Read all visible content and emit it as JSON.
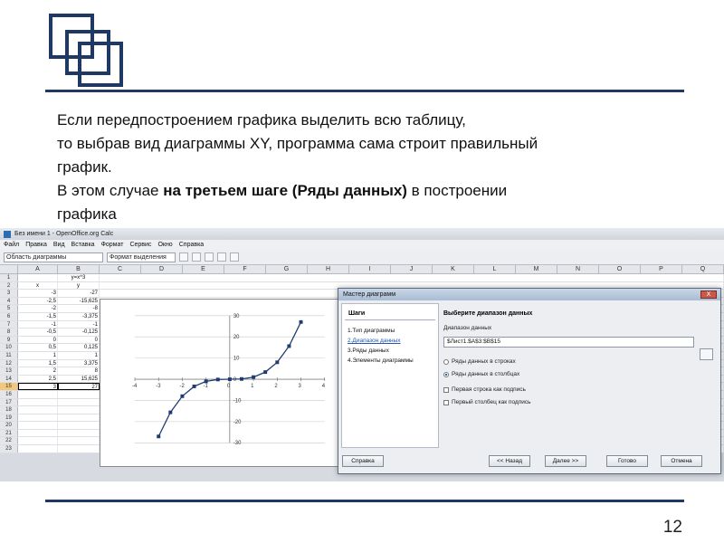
{
  "slide": {
    "paragraph": {
      "line1": "Если передпостроением графика выделить всю таблицу,",
      "line2": "то выбрав вид диаграммы XY, программа сама строит правильный",
      "line3": "график.",
      "line4_pre": "В этом случае ",
      "line4_bold": "на третьем шаге (Ряды данных)",
      "line4_post": " в построении",
      "line5": "графика"
    },
    "page_number": "12",
    "accent_color": "#1f3864"
  },
  "app": {
    "window_title": "Без имени 1 - OpenOffice.org Calc",
    "menu": [
      "Файл",
      "Правка",
      "Вид",
      "Вставка",
      "Формат",
      "Сервис",
      "Окно",
      "Справка"
    ],
    "name_box": "Область диаграммы",
    "toolbar_dropdown": "Формат выделения",
    "columns": [
      "A",
      "B",
      "C",
      "D",
      "E",
      "F",
      "G",
      "H",
      "I",
      "J",
      "K",
      "L",
      "M",
      "N",
      "O",
      "P",
      "Q"
    ],
    "rows": [
      {
        "n": "1",
        "a": "",
        "b": "y=x^3"
      },
      {
        "n": "2",
        "a": "x",
        "b": "y"
      },
      {
        "n": "3",
        "a": "-3",
        "b": "-27"
      },
      {
        "n": "4",
        "a": "-2,5",
        "b": "-15,625"
      },
      {
        "n": "5",
        "a": "-2",
        "b": "-8"
      },
      {
        "n": "6",
        "a": "-1,5",
        "b": "-3,375"
      },
      {
        "n": "7",
        "a": "-1",
        "b": "-1"
      },
      {
        "n": "8",
        "a": "-0,5",
        "b": "-0,125"
      },
      {
        "n": "9",
        "a": "0",
        "b": "0"
      },
      {
        "n": "10",
        "a": "0,5",
        "b": "0,125"
      },
      {
        "n": "11",
        "a": "1",
        "b": "1"
      },
      {
        "n": "12",
        "a": "1,5",
        "b": "3,375"
      },
      {
        "n": "13",
        "a": "2",
        "b": "8"
      },
      {
        "n": "14",
        "a": "2,5",
        "b": "15,625"
      },
      {
        "n": "15",
        "a": "3",
        "b": "27"
      },
      {
        "n": "16",
        "a": "",
        "b": ""
      },
      {
        "n": "17",
        "a": "",
        "b": ""
      },
      {
        "n": "18",
        "a": "",
        "b": ""
      },
      {
        "n": "19",
        "a": "",
        "b": ""
      },
      {
        "n": "20",
        "a": "",
        "b": ""
      },
      {
        "n": "21",
        "a": "",
        "b": ""
      },
      {
        "n": "22",
        "a": "",
        "b": ""
      },
      {
        "n": "23",
        "a": "",
        "b": ""
      }
    ]
  },
  "chart_data": {
    "type": "scatter",
    "x": [
      -3,
      -2.5,
      -2,
      -1.5,
      -1,
      -0.5,
      0,
      0.5,
      1,
      1.5,
      2,
      2.5,
      3
    ],
    "y": [
      -27,
      -15.625,
      -8,
      -3.375,
      -1,
      -0.125,
      0,
      0.125,
      1,
      3.375,
      8,
      15.625,
      27
    ],
    "xlim": [
      -4,
      4
    ],
    "ylim": [
      -30,
      30
    ],
    "x_ticks": [
      "-4",
      "-3",
      "-2",
      "-1",
      "0",
      "1",
      "2",
      "3",
      "4"
    ],
    "y_ticks": [
      "30",
      "20",
      "10",
      "0",
      "-10",
      "-20",
      "-30"
    ],
    "grid": "horizontal",
    "line_color": "#1f3c6e",
    "marker": "square"
  },
  "dialog": {
    "title": "Мастер диаграмм",
    "close_label": "X",
    "steps_header": "Шаги",
    "steps": [
      "1.Тип диаграммы",
      "2.Диапазон данных",
      "3.Ряды данных",
      "4.Элементы диаграммы"
    ],
    "heading": "Выберите диапазон данных",
    "range_label": "Диапазон данных",
    "range_value": "$Лист1.$A$3:$B$15",
    "options": {
      "rows": "Ряды данных в строках",
      "columns": "Ряды данных в столбцах",
      "first_row": "Первая строка как подпись",
      "first_col": "Первый столбец как подпись"
    },
    "buttons": {
      "help": "Справка",
      "back": "<< Назад",
      "next": "Далее >>",
      "finish": "Готово",
      "cancel": "Отмена"
    }
  }
}
